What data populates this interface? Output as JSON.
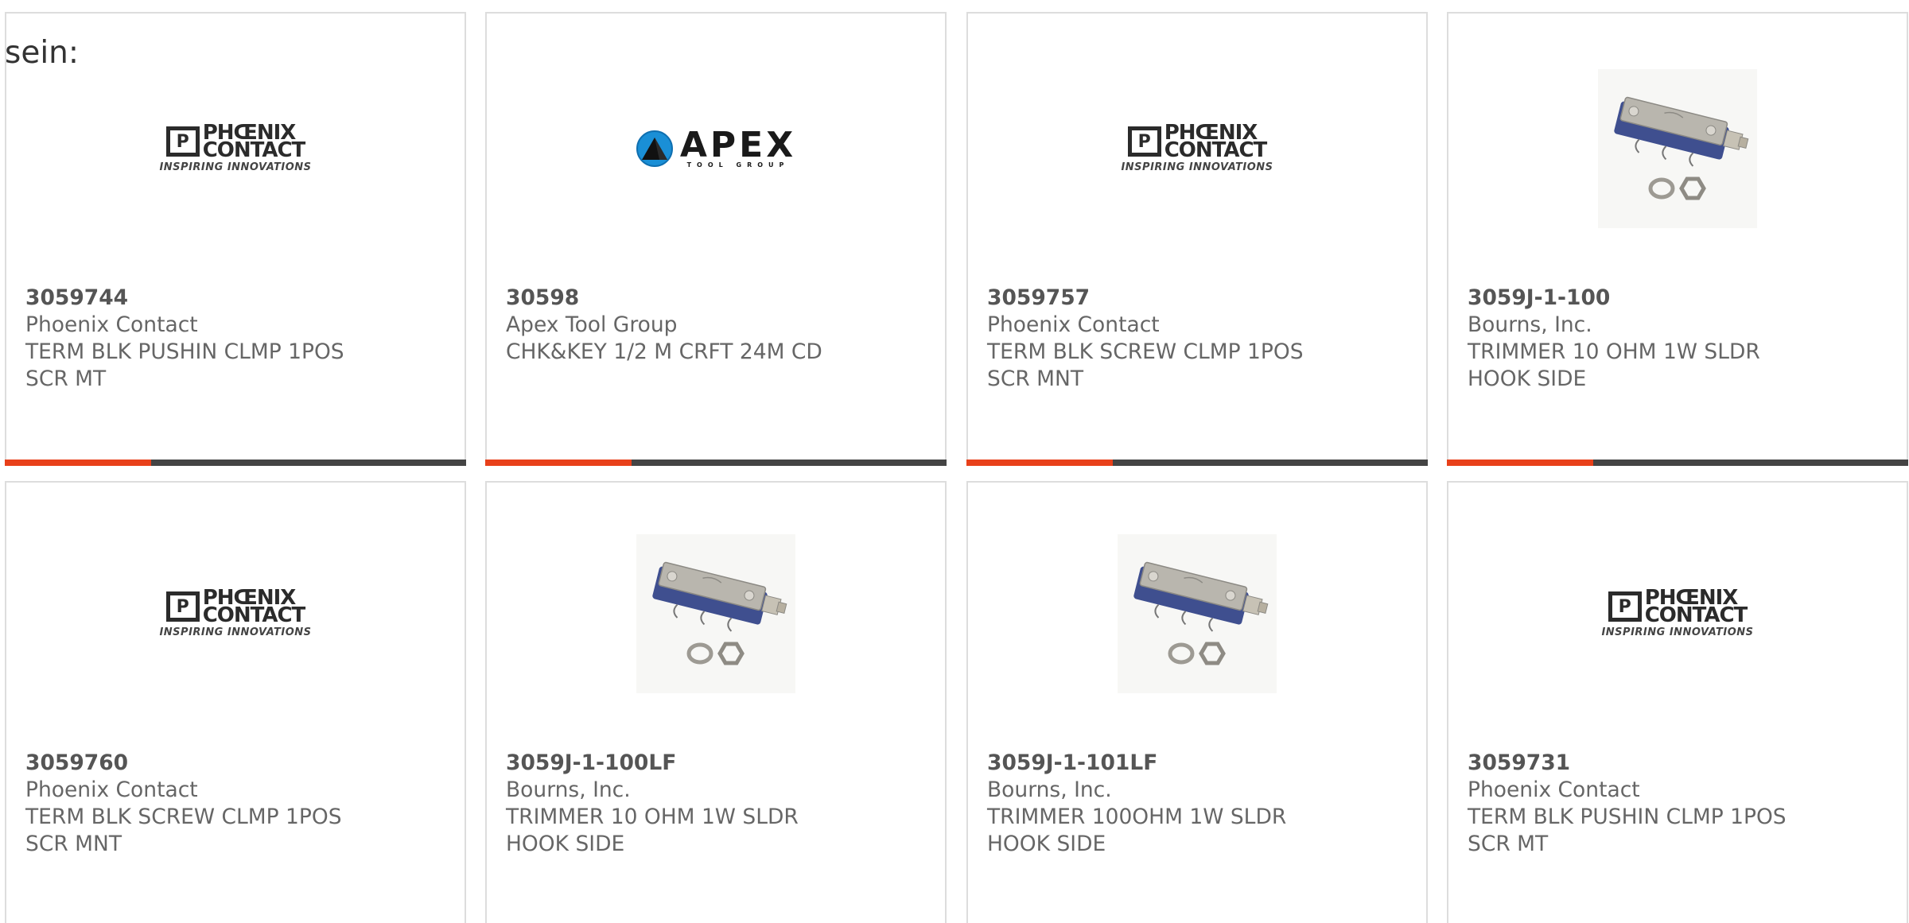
{
  "intro_text": "sein:",
  "products": [
    {
      "part_number": "3059744",
      "manufacturer": "Phoenix Contact",
      "desc_line1": "TERM BLK PUSHIN CLMP 1POS",
      "desc_line2": "SCR MT",
      "image": "phoenix-contact-logo",
      "logo_word1": "PHŒNIX",
      "logo_word2": "CONTACT",
      "logo_tagline": "INSPIRING INNOVATIONS"
    },
    {
      "part_number": "30598",
      "manufacturer": "Apex Tool Group",
      "desc_line1": "CHK&KEY 1/2 M CRFT 24M CD",
      "desc_line2": "",
      "image": "apex-tool-group-logo",
      "logo_word1": "APEX",
      "logo_tagline": "TOOL GROUP"
    },
    {
      "part_number": "3059757",
      "manufacturer": "Phoenix Contact",
      "desc_line1": "TERM BLK SCREW CLMP 1POS",
      "desc_line2": "SCR MNT",
      "image": "phoenix-contact-logo",
      "logo_word1": "PHŒNIX",
      "logo_word2": "CONTACT",
      "logo_tagline": "INSPIRING INNOVATIONS"
    },
    {
      "part_number": "3059J-1-100",
      "manufacturer": "Bourns, Inc.",
      "desc_line1": "TRIMMER 10 OHM 1W SLDR",
      "desc_line2": "HOOK SIDE",
      "image": "trimmer-potentiometer-photo"
    },
    {
      "part_number": "3059760",
      "manufacturer": "Phoenix Contact",
      "desc_line1": "TERM BLK SCREW CLMP 1POS",
      "desc_line2": "SCR MNT",
      "image": "phoenix-contact-logo",
      "logo_word1": "PHŒNIX",
      "logo_word2": "CONTACT",
      "logo_tagline": "INSPIRING INNOVATIONS"
    },
    {
      "part_number": "3059J-1-100LF",
      "manufacturer": "Bourns, Inc.",
      "desc_line1": "TRIMMER 10 OHM 1W SLDR",
      "desc_line2": "HOOK SIDE",
      "image": "trimmer-potentiometer-photo"
    },
    {
      "part_number": "3059J-1-101LF",
      "manufacturer": "Bourns, Inc.",
      "desc_line1": "TRIMMER 100OHM 1W SLDR",
      "desc_line2": "HOOK SIDE",
      "image": "trimmer-potentiometer-photo"
    },
    {
      "part_number": "3059731",
      "manufacturer": "Phoenix Contact",
      "desc_line1": "TERM BLK PUSHIN CLMP 1POS",
      "desc_line2": "SCR MT",
      "image": "phoenix-contact-logo",
      "logo_word1": "PHŒNIX",
      "logo_word2": "CONTACT",
      "logo_tagline": "INSPIRING INNOVATIONS"
    }
  ],
  "colors": {
    "accent": "#e8401a",
    "bar": "#444444",
    "border": "#dddddd",
    "text": "#666666"
  }
}
